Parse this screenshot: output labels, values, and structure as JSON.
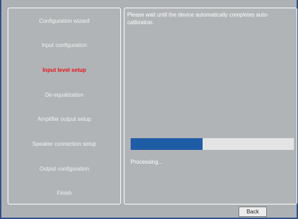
{
  "sidebar": {
    "items": [
      {
        "label": "Configuration wizard",
        "active": false
      },
      {
        "label": "Input configuration",
        "active": false
      },
      {
        "label": "Input level setup",
        "active": true
      },
      {
        "label": "De-equalization",
        "active": false
      },
      {
        "label": "Amplifier output setup",
        "active": false
      },
      {
        "label": "Speaker connection setup",
        "active": false
      },
      {
        "label": "Output configuration",
        "active": false
      },
      {
        "label": "Finish",
        "active": false
      }
    ]
  },
  "main": {
    "message": "Please wait until the device automatically completes auto-calibration.",
    "progress": {
      "fraction": 0.44,
      "status_text": "Processing..."
    }
  },
  "footer": {
    "back_label": "Back"
  },
  "colors": {
    "active_step": "#e8141b",
    "progress_fill": "#1f5ca6"
  }
}
